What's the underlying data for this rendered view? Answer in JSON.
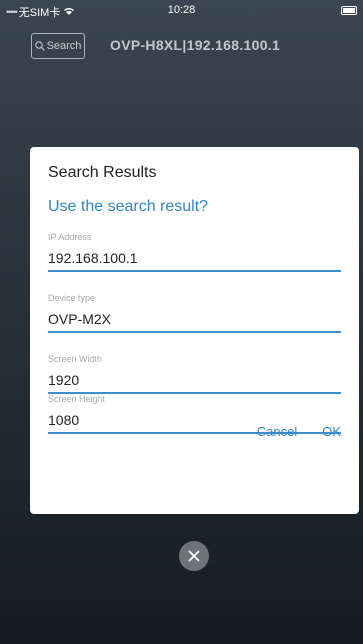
{
  "status_bar": {
    "carrier": "无SIM卡",
    "time": "10:28"
  },
  "header": {
    "search_label": "Search",
    "title": "OVP-H8XL|192.168.100.1"
  },
  "dialog": {
    "title": "Search Results",
    "question": "Use the search result?",
    "fields": [
      {
        "label": "IP Address",
        "value": "192.168.100.1"
      },
      {
        "label": "Device type",
        "value": "OVP-M2X"
      },
      {
        "label": "Screen Width",
        "value": "1920"
      },
      {
        "label": "Screen Height",
        "value": "1080"
      }
    ],
    "cancel_label": "Cancel",
    "ok_label": "OK"
  },
  "colors": {
    "accent": "#2f87c9",
    "underline": "#3b8ed0"
  }
}
